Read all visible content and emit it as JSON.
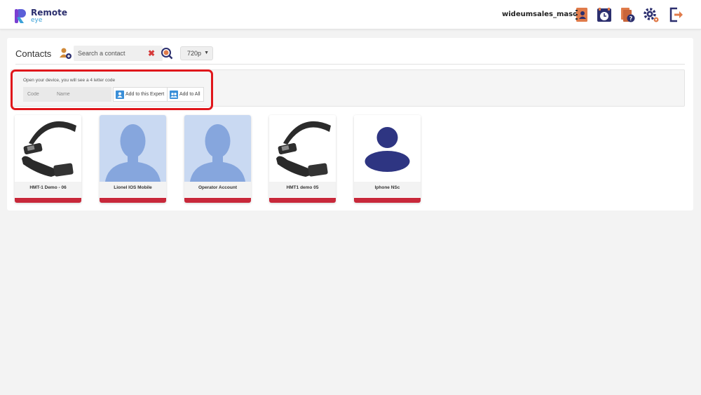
{
  "app": {
    "name": "Remote",
    "sub": "eye"
  },
  "header": {
    "username": "wideumsales_masot",
    "icons": [
      "contacts-book-icon",
      "history-clock-icon",
      "help-files-icon",
      "settings-gears-icon",
      "logout-icon"
    ]
  },
  "contacts": {
    "title": "Contacts",
    "search_placeholder": "Search a contact",
    "resolution": "720p"
  },
  "pairing": {
    "hint": "Open your device, you will see a 4 letter code",
    "code_placeholder": "Code",
    "name_placeholder": "Name",
    "add_expert_label": "Add to this Expert",
    "add_all_label": "Add to All"
  },
  "cards": [
    {
      "name": "HMT-1 Demo - 06",
      "image": "headset"
    },
    {
      "name": "Lionel IOS Mobile",
      "image": "silhouette"
    },
    {
      "name": "Operator Account",
      "image": "silhouette"
    },
    {
      "name": "HMT1 demo 05",
      "image": "headset"
    },
    {
      "name": "Iphone NSc",
      "image": "avatar"
    }
  ],
  "colors": {
    "accent_red": "#c8283a",
    "brand_navy": "#2c2f6e",
    "frame_red": "#e0161b"
  }
}
